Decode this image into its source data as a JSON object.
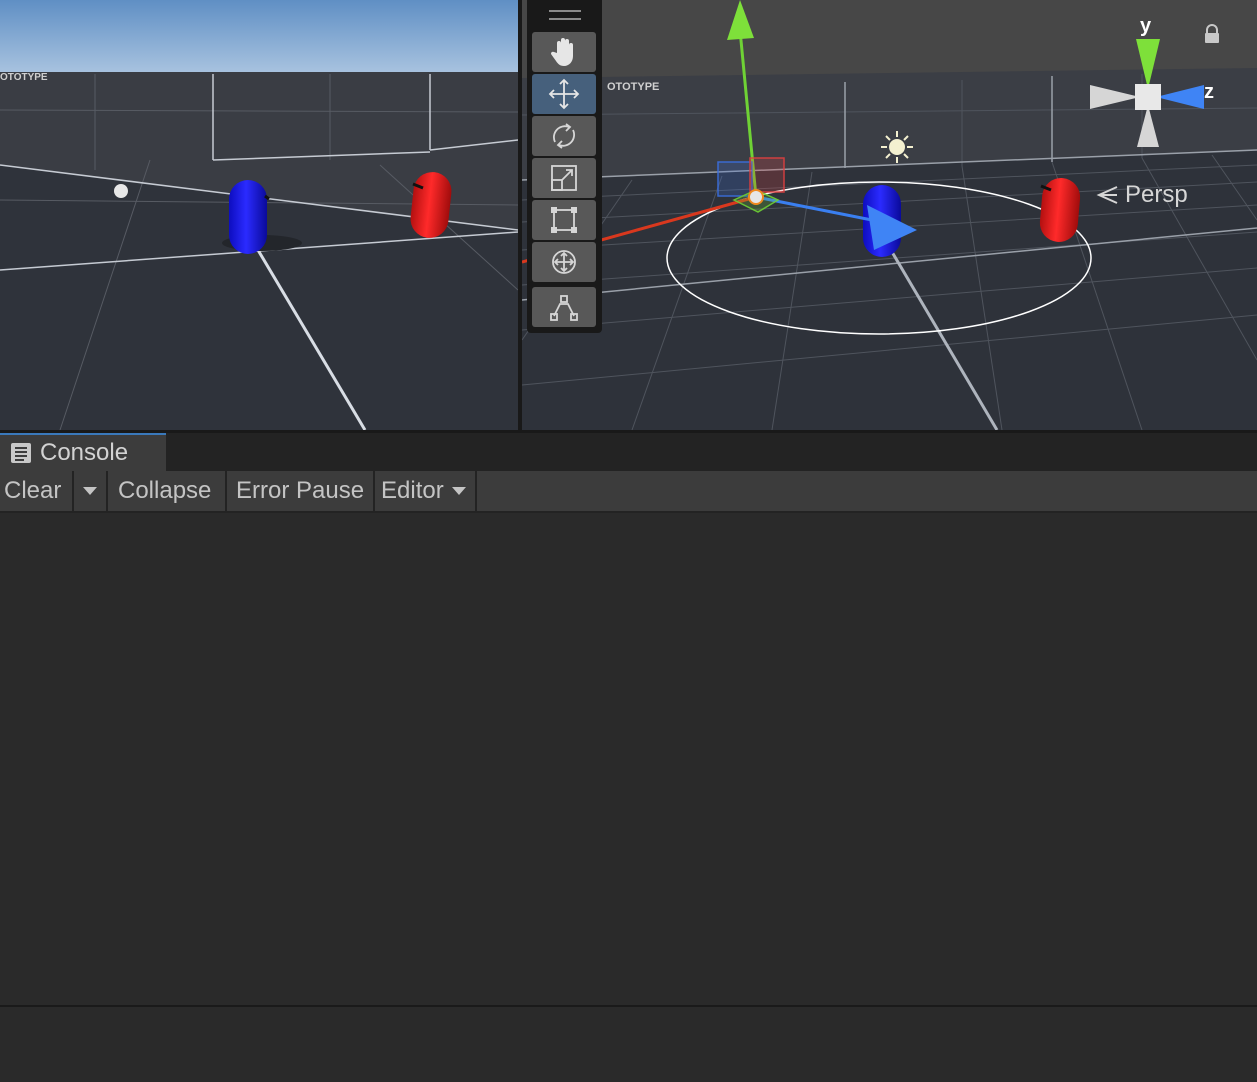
{
  "scene": {
    "projection_label": "Persp",
    "axis_labels": {
      "y": "y",
      "z": "z"
    },
    "tools": [
      {
        "name": "hand-tool",
        "icon": "hand-icon",
        "active": false
      },
      {
        "name": "move-tool",
        "icon": "move-arrows-icon",
        "active": true
      },
      {
        "name": "rotate-tool",
        "icon": "rotate-icon",
        "active": false
      },
      {
        "name": "scale-tool",
        "icon": "scale-icon",
        "active": false
      },
      {
        "name": "rect-tool",
        "icon": "rect-transform-icon",
        "active": false
      },
      {
        "name": "transform-tool",
        "icon": "transform-icon",
        "active": false
      },
      {
        "name": "custom-tool",
        "icon": "custom-editor-tool-icon",
        "active": false
      }
    ],
    "colors": {
      "capsule_blue": "#1a1aff",
      "capsule_red": "#e81e1e",
      "accent_tab": "#3a79bb",
      "active_tool": "#46607c"
    }
  },
  "console": {
    "tab_label": "Console",
    "toolbar": {
      "clear_label": "Clear",
      "collapse_label": "Collapse",
      "error_pause_label": "Error Pause",
      "editor_label": "Editor"
    }
  }
}
